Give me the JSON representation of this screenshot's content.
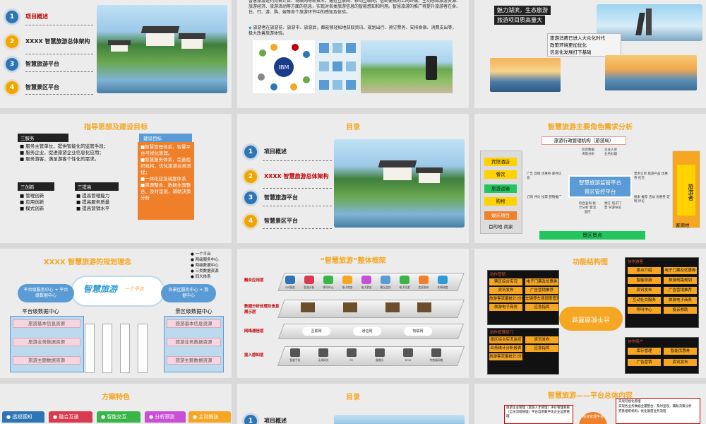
{
  "toc": {
    "items": [
      {
        "num": "1",
        "label": "项目概述"
      },
      {
        "num": "2",
        "label": "XXXX 智慧旅游总体架构"
      },
      {
        "num": "3",
        "label": "智慧旅游平台"
      },
      {
        "num": "4",
        "label": "智慧景区平台"
      }
    ]
  },
  "slide2": {
    "para1": "智慧旅游是利用云计算、物联网等新技术，通过互联网、移动互联网，借助便携的上网终端，主动感知旅游资源、旅游经济、旅游活动等方面的信息，实现对各类旅游信息的智能感知和利用。智慧旅游的推广将提升旅游者在食、住、行、游、购、娱等各个旅游环节中的感知及体验。",
    "para2": "旅游者在旅游前、旅游中、旅游后，都能够轻松地获取资讯、规划出行、预订票务、安排食宿、消费支出等，极大改善旅游体验。"
  },
  "slide3": {
    "heading_line1": "魅力湖滨，生态旅游",
    "heading_line2": "旅游项目质高量大",
    "caption_line1": "旅游消费已进入大众化时代",
    "caption_line2": "政策环境更加优化",
    "caption_line3": "信息化发展打下基础"
  },
  "slide4": {
    "title": "指导思想及建设目标",
    "three_services": "三服务",
    "services": [
      "服务主管单位，提供智能化的监管手段；",
      "服务企业，促进旅游企业信息化应用；",
      "服务游客，满足游客个性化的需求。"
    ],
    "three_innov": "三创新",
    "innov": [
      "管理创新",
      "应用创新",
      "模式创新"
    ],
    "three_improve": "三提高",
    "improve": [
      "提高管理能力",
      "提高服务质量",
      "提高营销水平"
    ],
    "goal_head": "建设目标",
    "goals": [
      "智慧管理体系，智慧平台可视化管理。",
      "智慧服务体系，完善组织机构，优化旅游业务流程；",
      "一体化应急调度体系",
      "资源整合，数据全面整合、及时呈现、辅助决策分析"
    ]
  },
  "slide5": {
    "title": "目录"
  },
  "slide6": {
    "title": "智慧旅游主要角色需求分析",
    "top_box": "旅游行政管理机构（旅游局）",
    "left_items": [
      "宾馆酒店",
      "餐饮",
      "旅游运输",
      "购物",
      "娱乐项目"
    ],
    "left_caption": "目的地 商家",
    "center_line1": "智慧旅游监管平台",
    "center_line2": "景区管控平台",
    "right_box": "旅游者",
    "right_caption": "客源地",
    "bottom_box": "景区景点",
    "notes": {
      "top_left": "综合数据决策分析",
      "top_right": "企业入驻业务办理",
      "mid_left": "广告 促销 优惠券 库存信息",
      "mid_right": "票务订单 旅游产品 优惠券 社交",
      "low_left": "订购 评论 投票 营销推广",
      "low_right": "搜索 推荐 活动 优惠券 定制 评论",
      "bot_left": "综合查询 统计分析 客流监控",
      "bot_right": "预订 电子门票 导游导览"
    }
  },
  "slide7": {
    "title": "XXXX 智慧旅游的规划理念",
    "bullets": [
      "一个平台",
      "两级服务中心",
      "两级数据中心",
      "三类数据资源",
      "四大体系"
    ],
    "logo_text": "智慧旅游",
    "logo_sub": "一个平台",
    "left_center": "平台级服务中心 + 平台级数据中心",
    "right_center": "各景区服务中心 + 数据中心",
    "left_head": "平台级数据中心",
    "left_rows": [
      "旅游基本信息资源",
      "旅游业务数据资源",
      "旅游主题数据资源"
    ],
    "right_head": "景区级数据中心",
    "right_rows": [
      "旅游基本信息资源",
      "旅游业务数据资源",
      "旅游主题数据资源"
    ]
  },
  "slide8": {
    "title": "“智慧旅游”整体框架",
    "layers": [
      "融合应用层",
      "数据分析处理及信息展示层",
      "网络通信层",
      "接入感知层"
    ],
    "app_icons": [
      "GIS服务",
      "智慧分析",
      "呼叫中心",
      "电子商务",
      "电子票务",
      "景区监控",
      "电子导游",
      "信息发布",
      "车辆调度"
    ],
    "net_labels": [
      "互联网",
      "通信网",
      "物联网"
    ],
    "sense_labels": [
      "智能手机",
      "无线网关",
      "PC",
      "摄像头",
      "RFID",
      "传感器网络"
    ]
  },
  "slide9": {
    "title": "功能结构图",
    "center_text": "智慧旅游平台",
    "block1_head": "协作营销",
    "block1_items": [
      "票区综合实况",
      "电子门票及优惠券",
      "资讯发布",
      "广告营销推荐",
      "旅游客流量统计/分析/预警",
      "车辆停车场调度管理",
      "旅游电子商务",
      "应急指挥"
    ],
    "block2_head": "协作管理部门",
    "block2_items": [
      "景区综合实况监控",
      "资讯发布",
      "业务统计分析报表",
      "应急指挥",
      "旅游客流量统计/分析/预警"
    ],
    "block3_head": "协作游客",
    "block3_items": [
      "景点介绍",
      "电子门票及优惠券",
      "智能导游",
      "旅游线路规划",
      "资讯发布",
      "广告营销推荐",
      "互动社交服务",
      "旅游电子商务",
      "呼叫中心",
      "投诉救助"
    ],
    "block4_head": "协作商户",
    "block4_items": [
      "库存管理",
      "智能优惠券",
      "广告营销",
      "资讯发布"
    ]
  },
  "slide10": {
    "title": "方案特色",
    "features": [
      "透视感知",
      "融合互通",
      "智能交互",
      "分析预测",
      "主动推送"
    ]
  },
  "slide11": {
    "title": "目录",
    "first_item": "项目概述"
  },
  "slide12": {
    "title": "智慧旅游——平台总体内容",
    "left_text": "旅游企业管理（旅游人才管理）评价管理系统（全员流程管理）平台自带数字化企业运营管理",
    "center_text": "综合管理平台",
    "right_text1": "实现可视化管理",
    "right_text2": "实现各业务数据全量整合，及时呈现，辅助决策分析",
    "right_text3": "完善组织机构，优化旅游业务流程"
  }
}
